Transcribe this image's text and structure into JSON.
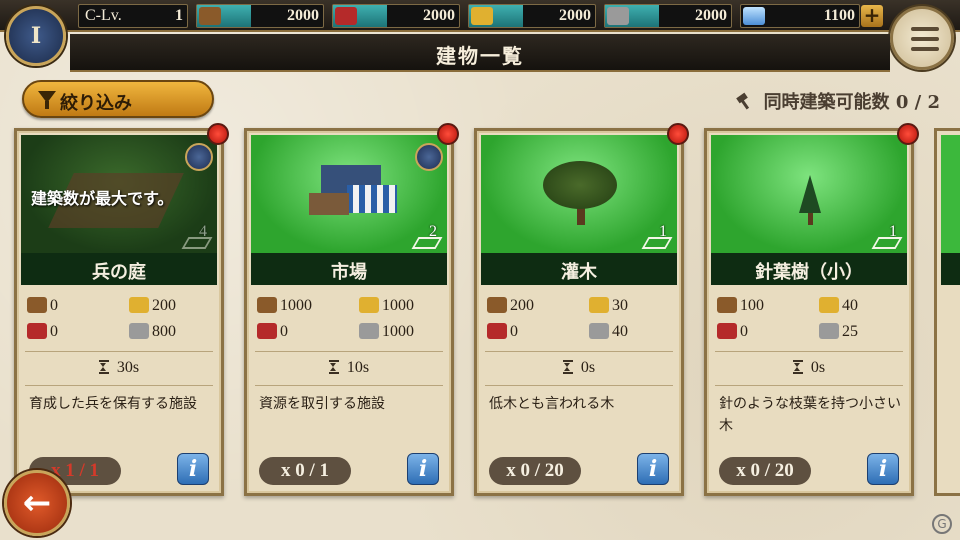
{
  "header": {
    "c_level_label": "C-Lv.",
    "c_level_value": "1",
    "resources": [
      {
        "name": "wood",
        "icon": "wood-icon",
        "value": "2000",
        "color": "#8a5a2a"
      },
      {
        "name": "meat",
        "icon": "meat-icon",
        "value": "2000",
        "color": "#b52a2a"
      },
      {
        "name": "gold",
        "icon": "gold-icon",
        "value": "2000",
        "color": "#e0b030"
      },
      {
        "name": "stone",
        "icon": "stone-icon",
        "value": "2000",
        "color": "#9a9a9a"
      }
    ],
    "gems": {
      "icon": "gem-icon",
      "value": "1100",
      "plus_label": "+"
    },
    "emblem_label": "I"
  },
  "title": "建物一覧",
  "filter_label": "絞り込み",
  "simultaneous": "同時建築可能数 0 / 2",
  "cards": [
    {
      "name": "兵の庭",
      "max_message": "建築数が最大です。",
      "level": "4",
      "costs": {
        "wood": "0",
        "gold": "200",
        "meat": "0",
        "stone": "800"
      },
      "time": "30s",
      "description": "育成した兵を保有する施設",
      "count": "x 1 / 1",
      "info": "i"
    },
    {
      "name": "市場",
      "level": "2",
      "costs": {
        "wood": "1000",
        "gold": "1000",
        "meat": "0",
        "stone": "1000"
      },
      "time": "10s",
      "description": "資源を取引する施設",
      "count": "x 0 / 1",
      "info": "i"
    },
    {
      "name": "灌木",
      "level": "1",
      "costs": {
        "wood": "200",
        "gold": "30",
        "meat": "0",
        "stone": "40"
      },
      "time": "0s",
      "description": "低木とも言われる木",
      "count": "x 0 / 20",
      "info": "i"
    },
    {
      "name": "針葉樹（小）",
      "level": "1",
      "costs": {
        "wood": "100",
        "gold": "40",
        "meat": "0",
        "stone": "25"
      },
      "time": "0s",
      "description": "針のような枝葉を持つ小さい木",
      "count": "x 0 / 20",
      "info": "i"
    }
  ],
  "back_label": "←",
  "watermark": "G"
}
